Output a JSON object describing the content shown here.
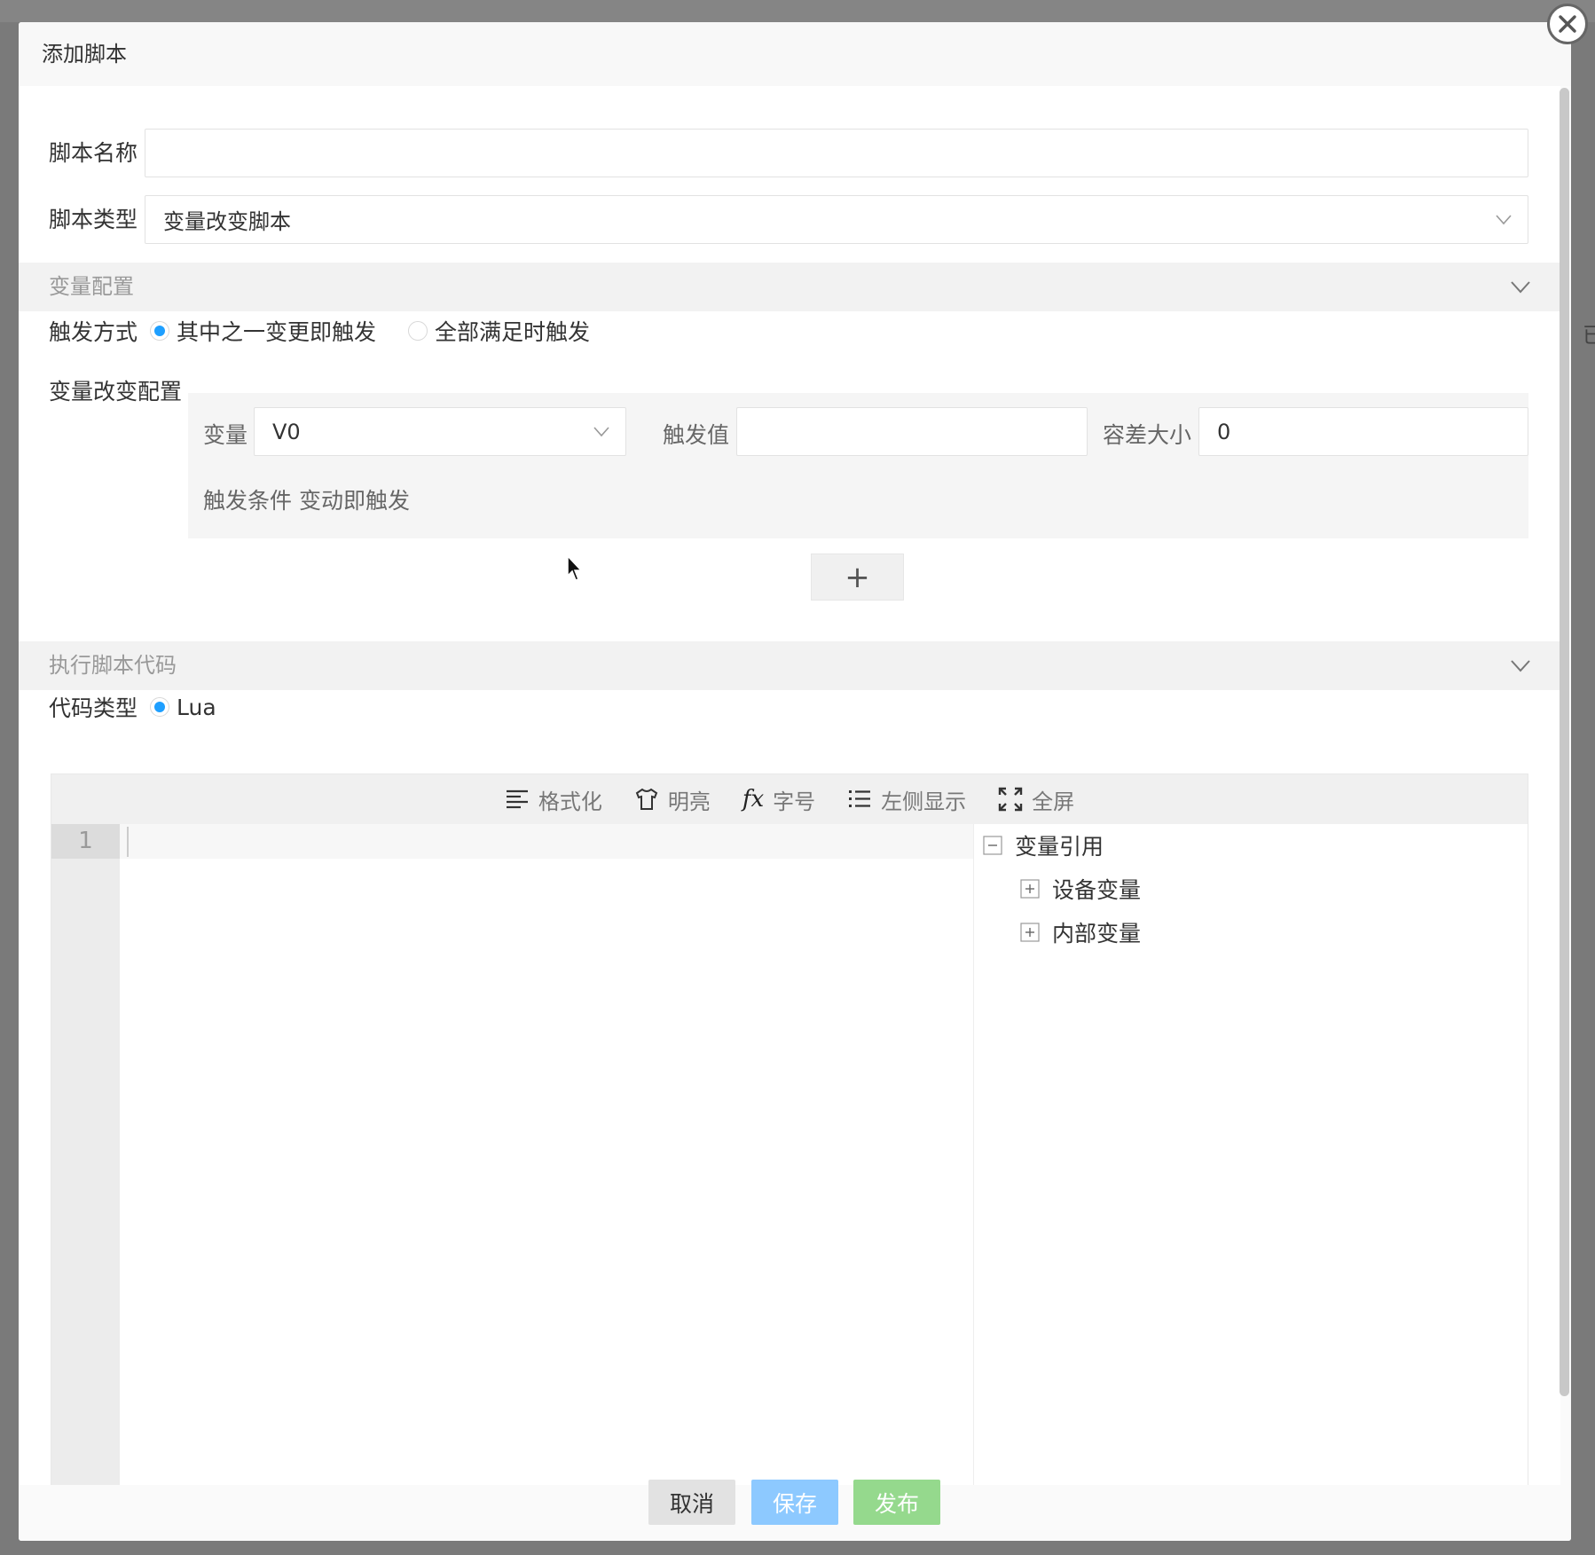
{
  "dialog": {
    "title": "添加脚本"
  },
  "form": {
    "script_name_label": "脚本名称",
    "script_name_value": "",
    "script_type_label": "脚本类型",
    "script_type_value": "变量改变脚本"
  },
  "variable_section": {
    "header": "变量配置",
    "trigger_mode_label": "触发方式",
    "trigger_options": [
      {
        "label": "其中之一变更即触发",
        "checked": true
      },
      {
        "label": "全部满足时触发",
        "checked": false
      }
    ],
    "change_config_label": "变量改变配置",
    "variable_label": "变量",
    "variable_value": "V0",
    "trigger_value_label": "触发值",
    "trigger_value": "",
    "tolerance_label": "容差大小",
    "tolerance_value": "0",
    "trigger_condition_text": "触发条件 变动即触发",
    "add_button_label": "+"
  },
  "code_section": {
    "header": "执行脚本代码",
    "code_type_label": "代码类型",
    "code_type_option": "Lua",
    "toolbar": {
      "format": "格式化",
      "theme": "明亮",
      "fx": "fx",
      "font_size": "字号",
      "left_display": "左侧显示",
      "fullscreen": "全屏"
    },
    "line_number": "1",
    "tree": {
      "root": "变量引用",
      "children": [
        "设备变量",
        "内部变量"
      ]
    }
  },
  "footer": {
    "cancel": "取消",
    "save": "保存",
    "publish": "发布"
  },
  "colors": {
    "primary_blue": "#1e9fff",
    "save_btn": "#8dc9ff",
    "publish_btn": "#95d98d"
  },
  "background_hint_text": "已"
}
